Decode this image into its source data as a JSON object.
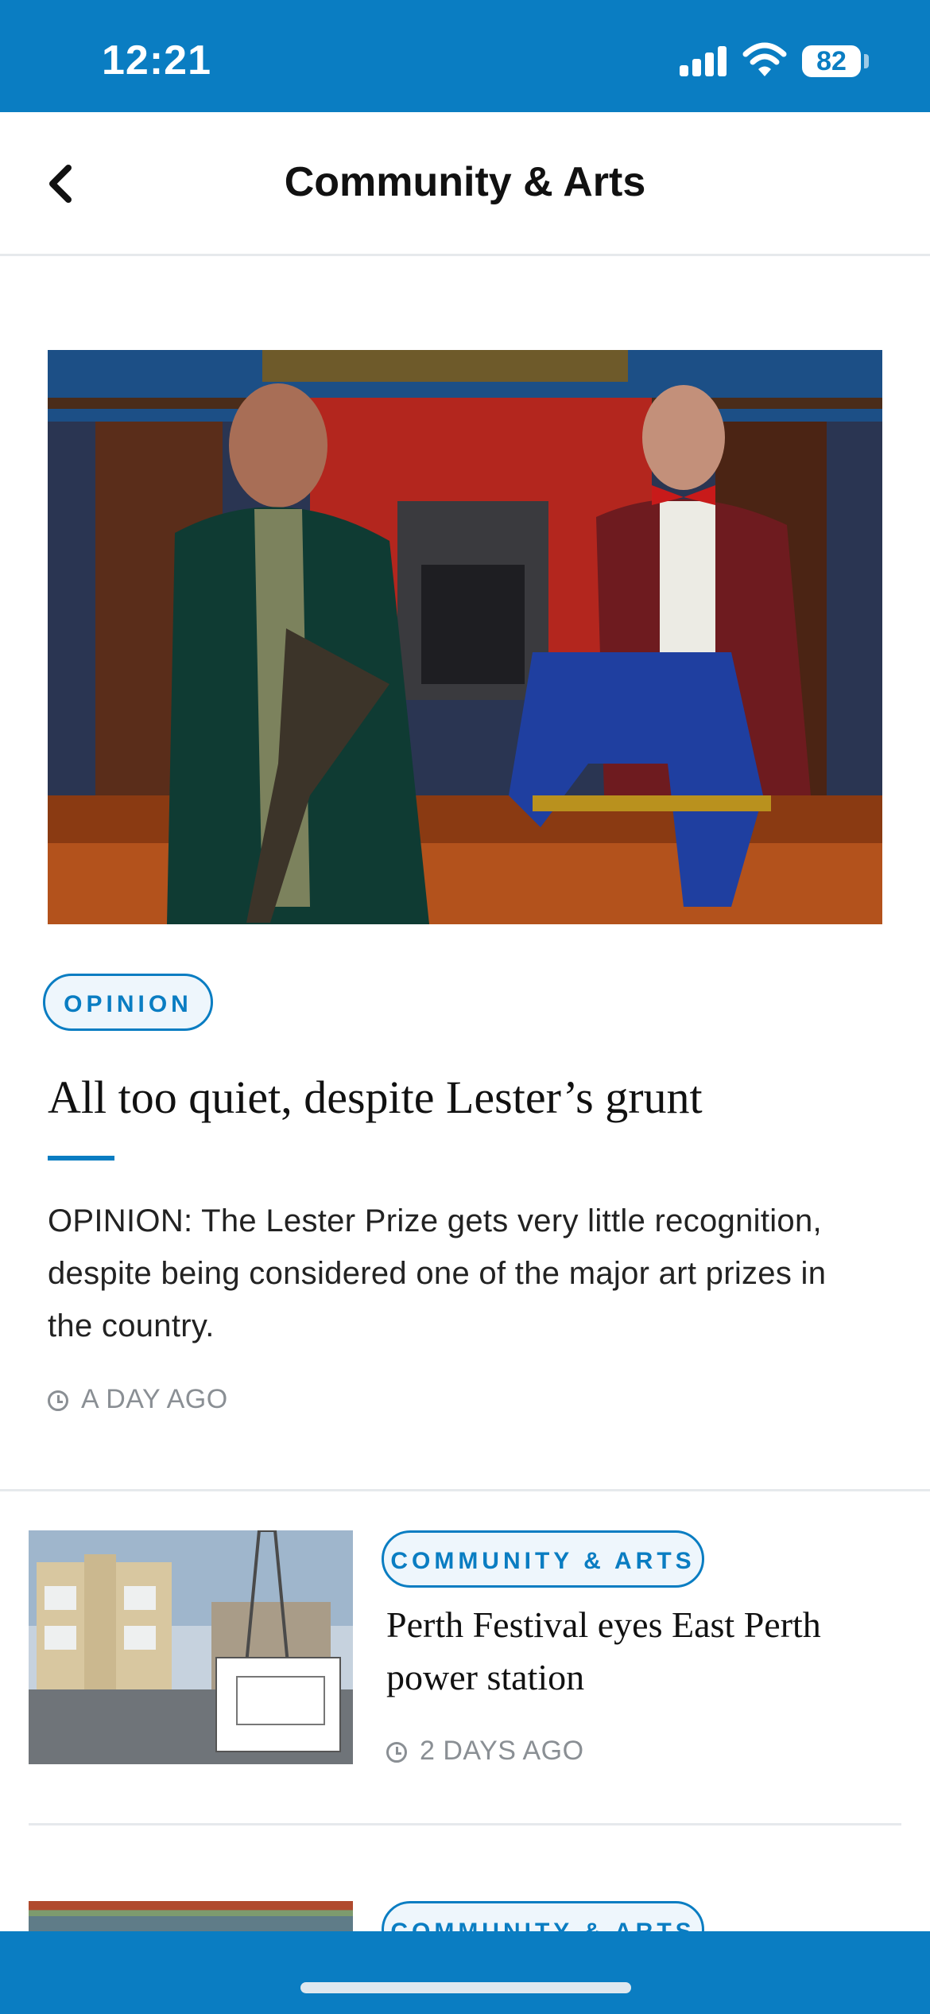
{
  "status_bar": {
    "time": "12:21",
    "battery": "82"
  },
  "nav": {
    "title": "Community & Arts"
  },
  "featured": {
    "tag": "OPINION",
    "headline": "All too quiet, despite Lester’s grunt",
    "excerpt": "OPINION: The Lester Prize gets very little recognition, despite being considered one of the major art prizes in the country.",
    "time": "A DAY AGO"
  },
  "articles": [
    {
      "tag": "COMMUNITY & ARTS",
      "headline": "Perth Festival eyes East Perth power station",
      "time": "2 DAYS AGO"
    },
    {
      "tag": "COMMUNITY & ARTS"
    }
  ],
  "colors": {
    "brand": "#0a7dc2",
    "tag_bg": "#eef6fc",
    "divider": "#e6e9ec"
  }
}
